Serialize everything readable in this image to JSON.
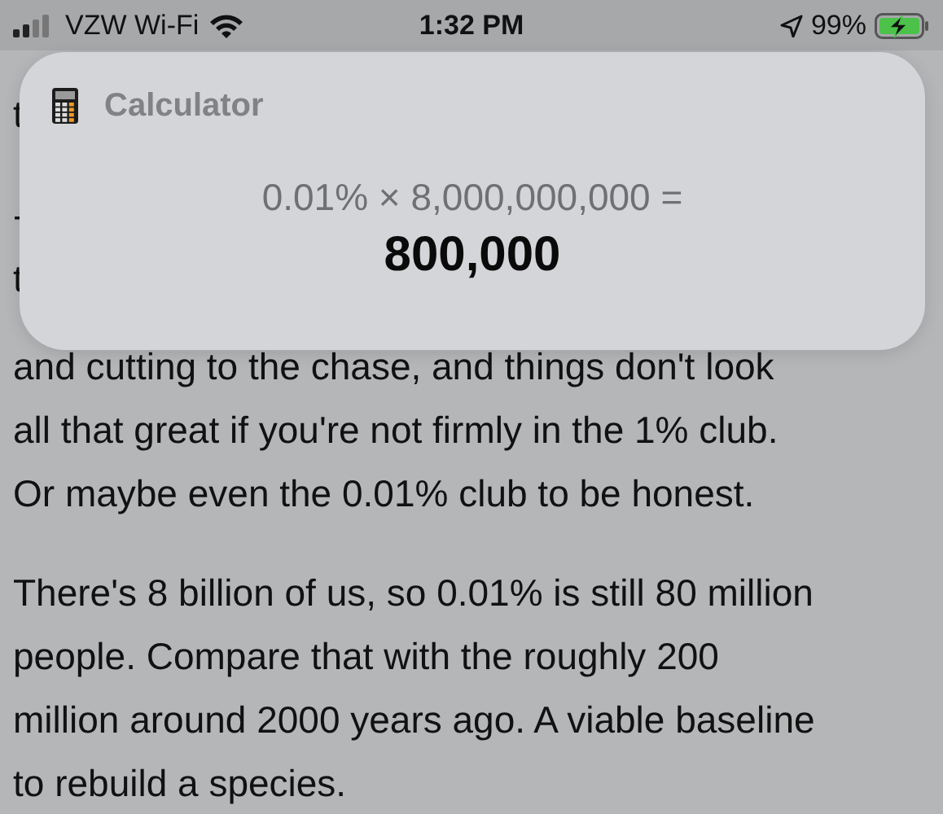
{
  "status_bar": {
    "carrier": "VZW Wi-Fi",
    "time": "1:32 PM",
    "battery": "99%"
  },
  "notification": {
    "app": "Calculator",
    "expression": "0.01% × 8,000,000,000 =",
    "result": "800,000"
  },
  "article": {
    "paragraphs": [
      {
        "lines": [
          "t",
          "-",
          "t",
          "and cutting to the chase, and things don't look",
          "all that great if you're not firmly in the 1% club.",
          "Or maybe even the 0.01% club to be honest."
        ]
      },
      {
        "lines": [
          "There's 8 billion of us, so 0.01% is still 80 million",
          "people. Compare that with the roughly 200",
          "million around 2000 years ago. A viable baseline",
          "to rebuild a species."
        ]
      }
    ]
  }
}
